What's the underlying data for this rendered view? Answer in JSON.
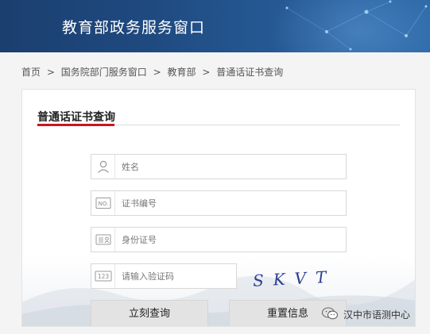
{
  "header": {
    "title": "教育部政务服务窗口"
  },
  "breadcrumb": {
    "items": [
      "首页",
      ">",
      "国务院部门服务窗口",
      ">",
      "教育部",
      ">",
      "普通话证书查询"
    ]
  },
  "form": {
    "title": "普通话证书查询",
    "name_placeholder": "姓名",
    "cert_placeholder": "证书编号",
    "id_placeholder": "身份证号",
    "captcha_placeholder": "请输入验证码",
    "captcha_text": "SKVT",
    "query_label": "立刻查询",
    "reset_label": "重置信息"
  },
  "watermark": {
    "text": "汉中市语测中心"
  },
  "colors": {
    "accent": "#c8161d",
    "banner": "#1f4a80"
  }
}
